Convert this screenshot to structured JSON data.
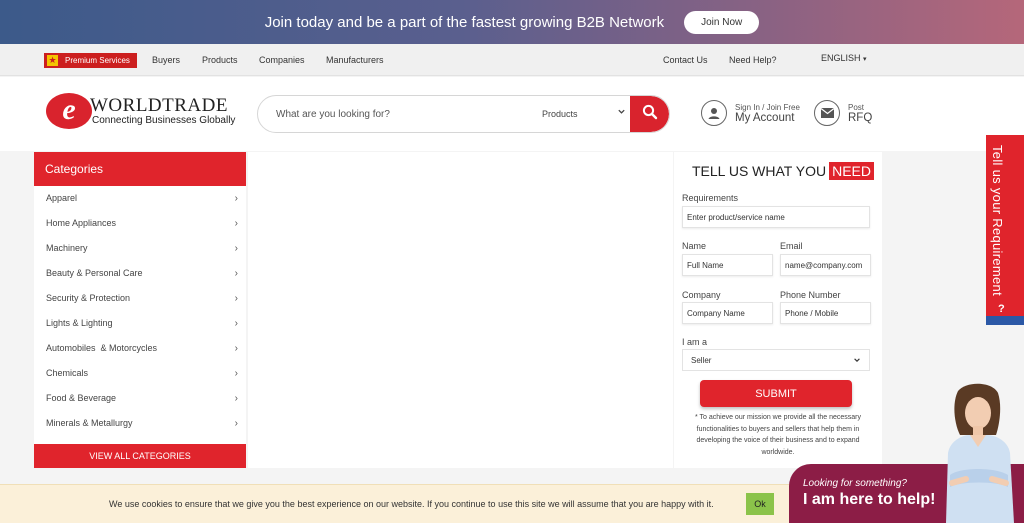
{
  "banner": {
    "text": "Join today and be a part of the fastest growing B2B Network",
    "button": "Join Now"
  },
  "nav": {
    "premium": "Premium Services",
    "links": [
      "Buyers",
      "Products",
      "Companies",
      "Manufacturers"
    ],
    "right_links": [
      "Contact Us",
      "Need Help?"
    ],
    "language": "ENGLISH"
  },
  "header": {
    "logo_name": "WORLDTRADE",
    "logo_letter": "e",
    "tagline": "Connecting Businesses Globally",
    "search_placeholder": "What are you looking for?",
    "search_scope": "Products",
    "account_small": "Sign In / Join Free",
    "account_big": "My Account",
    "rfq_small": "Post",
    "rfq_big": "RFQ"
  },
  "categories": {
    "title": "Categories",
    "items": [
      "Apparel",
      "Home Appliances",
      "Machinery",
      "Beauty & Personal Care",
      "Security & Protection",
      "Lights & Lighting",
      "Automobiles  & Motorcycles",
      "Chemicals",
      "Food & Beverage",
      "Minerals & Metallurgy"
    ],
    "view_all": "VIEW ALL CATEGORIES"
  },
  "form": {
    "title": "TELL US WHAT YOU",
    "title_highlight": "NEED",
    "requirements_label": "Requirements",
    "requirements_placeholder": "Enter product/service name",
    "name_label": "Name",
    "name_placeholder": "Full Name",
    "email_label": "Email",
    "email_placeholder": "name@company.com",
    "company_label": "Company",
    "company_placeholder": "Company Name",
    "phone_label": "Phone Number",
    "phone_placeholder": "Phone / Mobile",
    "role_label": "I am a",
    "role_value": "Seller",
    "submit": "SUBMIT",
    "note": "* To achieve our mission we provide all the necessary functionalities to buyers and sellers that help them in developing the voice of their business and to expand worldwide."
  },
  "side_tab": {
    "text": "Tell us your Requirement",
    "icon": "?"
  },
  "cookie": {
    "text": "We use cookies to ensure that we give you the best experience on our website. If you continue to use this site we will assume that you are happy with it.",
    "ok": "Ok"
  },
  "help": {
    "small": "Looking for something?",
    "big": "I am here to help!"
  },
  "colors": {
    "brand_red": "#e0242c",
    "help_bg": "#8c1d46",
    "side_tab_blue": "#2b58a6"
  }
}
